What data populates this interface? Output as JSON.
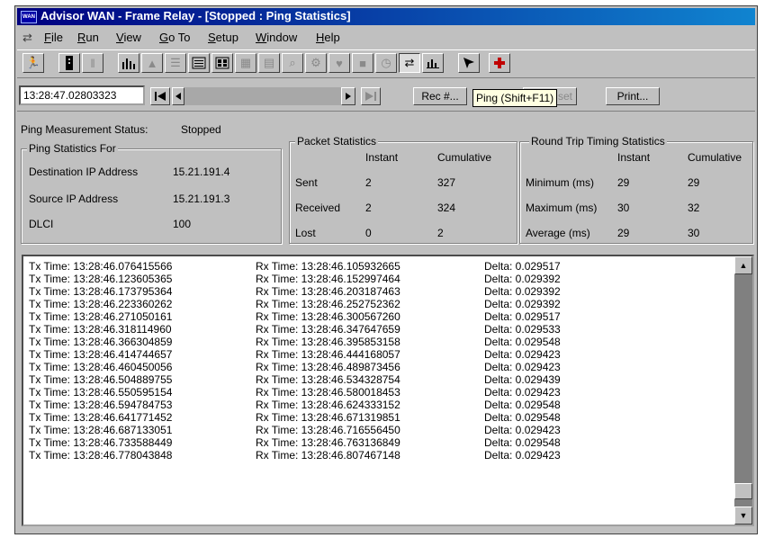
{
  "window": {
    "app_icon_text": "WAN",
    "title": "Advisor WAN - Frame Relay - [Stopped : Ping Statistics]"
  },
  "menu": {
    "items": [
      {
        "label": "File",
        "accel": "F",
        "rest": "ile"
      },
      {
        "label": "Run",
        "accel": "R",
        "rest": "un"
      },
      {
        "label": "View",
        "accel": "V",
        "rest": "iew"
      },
      {
        "label": "Go To",
        "accel": "G",
        "rest": "o To"
      },
      {
        "label": "Setup",
        "accel": "S",
        "rest": "etup"
      },
      {
        "label": "Window",
        "accel": "W",
        "rest": "indow"
      },
      {
        "label": "Help",
        "accel": "H",
        "rest": "elp"
      }
    ]
  },
  "toolbar": {
    "icons": [
      "run-icon",
      "stop-icon",
      "pause-icon",
      "bar-chart-icon",
      "area-chart-icon",
      "list-icon",
      "detail-list-icon",
      "grid-icon",
      "table-icon",
      "page-icon",
      "zoom-icon",
      "network-icon",
      "heart-icon",
      "trash-icon",
      "clock-icon",
      "ping-icon",
      "histogram-icon",
      "pointer-icon",
      "add-icon"
    ]
  },
  "nav": {
    "time_value": "13:28:47.02803323",
    "rec_label": "Rec #...",
    "reset_label": "set",
    "print_label": "Print...",
    "tooltip": "Ping (Shift+F11)"
  },
  "status": {
    "measurement_label": "Ping Measurement Status:",
    "measurement_value": "Stopped",
    "ping_for_title": "Ping Statistics For",
    "ping_for_rows": [
      {
        "label": "Destination IP Address",
        "value": "15.21.191.4"
      },
      {
        "label": "Source IP Address",
        "value": "15.21.191.3"
      },
      {
        "label": "DLCI",
        "value": "100"
      }
    ],
    "packet": {
      "title": "Packet Statistics",
      "col_instant": "Instant",
      "col_cumulative": "Cumulative",
      "rows": [
        {
          "label": "Sent",
          "instant": "2",
          "cumulative": "327"
        },
        {
          "label": "Received",
          "instant": "2",
          "cumulative": "324"
        },
        {
          "label": "Lost",
          "instant": "0",
          "cumulative": "2"
        }
      ]
    },
    "rtt": {
      "title": "Round Trip Timing Statistics",
      "col_instant": "Instant",
      "col_cumulative": "Cumulative",
      "rows": [
        {
          "label": "Minimum (ms)",
          "instant": "29",
          "cumulative": "29"
        },
        {
          "label": "Maximum (ms)",
          "instant": "30",
          "cumulative": "32"
        },
        {
          "label": "Average (ms)",
          "instant": "29",
          "cumulative": "30"
        }
      ]
    }
  },
  "log": {
    "rows": [
      {
        "tx": "Tx Time: 13:28:46.076415566",
        "rx": "Rx Time: 13:28:46.105932665",
        "delta": "Delta: 0.029517"
      },
      {
        "tx": "Tx Time: 13:28:46.123605365",
        "rx": "Rx Time: 13:28:46.152997464",
        "delta": "Delta: 0.029392"
      },
      {
        "tx": "Tx Time: 13:28:46.173795364",
        "rx": "Rx Time: 13:28:46.203187463",
        "delta": "Delta: 0.029392"
      },
      {
        "tx": "Tx Time: 13:28:46.223360262",
        "rx": "Rx Time: 13:28:46.252752362",
        "delta": "Delta: 0.029392"
      },
      {
        "tx": "Tx Time: 13:28:46.271050161",
        "rx": "Rx Time: 13:28:46.300567260",
        "delta": "Delta: 0.029517"
      },
      {
        "tx": "Tx Time: 13:28:46.318114960",
        "rx": "Rx Time: 13:28:46.347647659",
        "delta": "Delta: 0.029533"
      },
      {
        "tx": "Tx Time: 13:28:46.366304859",
        "rx": "Rx Time: 13:28:46.395853158",
        "delta": "Delta: 0.029548"
      },
      {
        "tx": "Tx Time: 13:28:46.414744657",
        "rx": "Rx Time: 13:28:46.444168057",
        "delta": "Delta: 0.029423"
      },
      {
        "tx": "Tx Time: 13:28:46.460450056",
        "rx": "Rx Time: 13:28:46.489873456",
        "delta": "Delta: 0.029423"
      },
      {
        "tx": "Tx Time: 13:28:46.504889755",
        "rx": "Rx Time: 13:28:46.534328754",
        "delta": "Delta: 0.029439"
      },
      {
        "tx": "Tx Time: 13:28:46.550595154",
        "rx": "Rx Time: 13:28:46.580018453",
        "delta": "Delta: 0.029423"
      },
      {
        "tx": "Tx Time: 13:28:46.594784753",
        "rx": "Rx Time: 13:28:46.624333152",
        "delta": "Delta: 0.029548"
      },
      {
        "tx": "Tx Time: 13:28:46.641771452",
        "rx": "Rx Time: 13:28:46.671319851",
        "delta": "Delta: 0.029548"
      },
      {
        "tx": "Tx Time: 13:28:46.687133051",
        "rx": "Rx Time: 13:28:46.716556450",
        "delta": "Delta: 0.029423"
      },
      {
        "tx": "Tx Time: 13:28:46.733588449",
        "rx": "Rx Time: 13:28:46.763136849",
        "delta": "Delta: 0.029548"
      },
      {
        "tx": "Tx Time: 13:28:46.778043848",
        "rx": "Rx Time: 13:28:46.807467148",
        "delta": "Delta: 0.029423"
      }
    ]
  }
}
